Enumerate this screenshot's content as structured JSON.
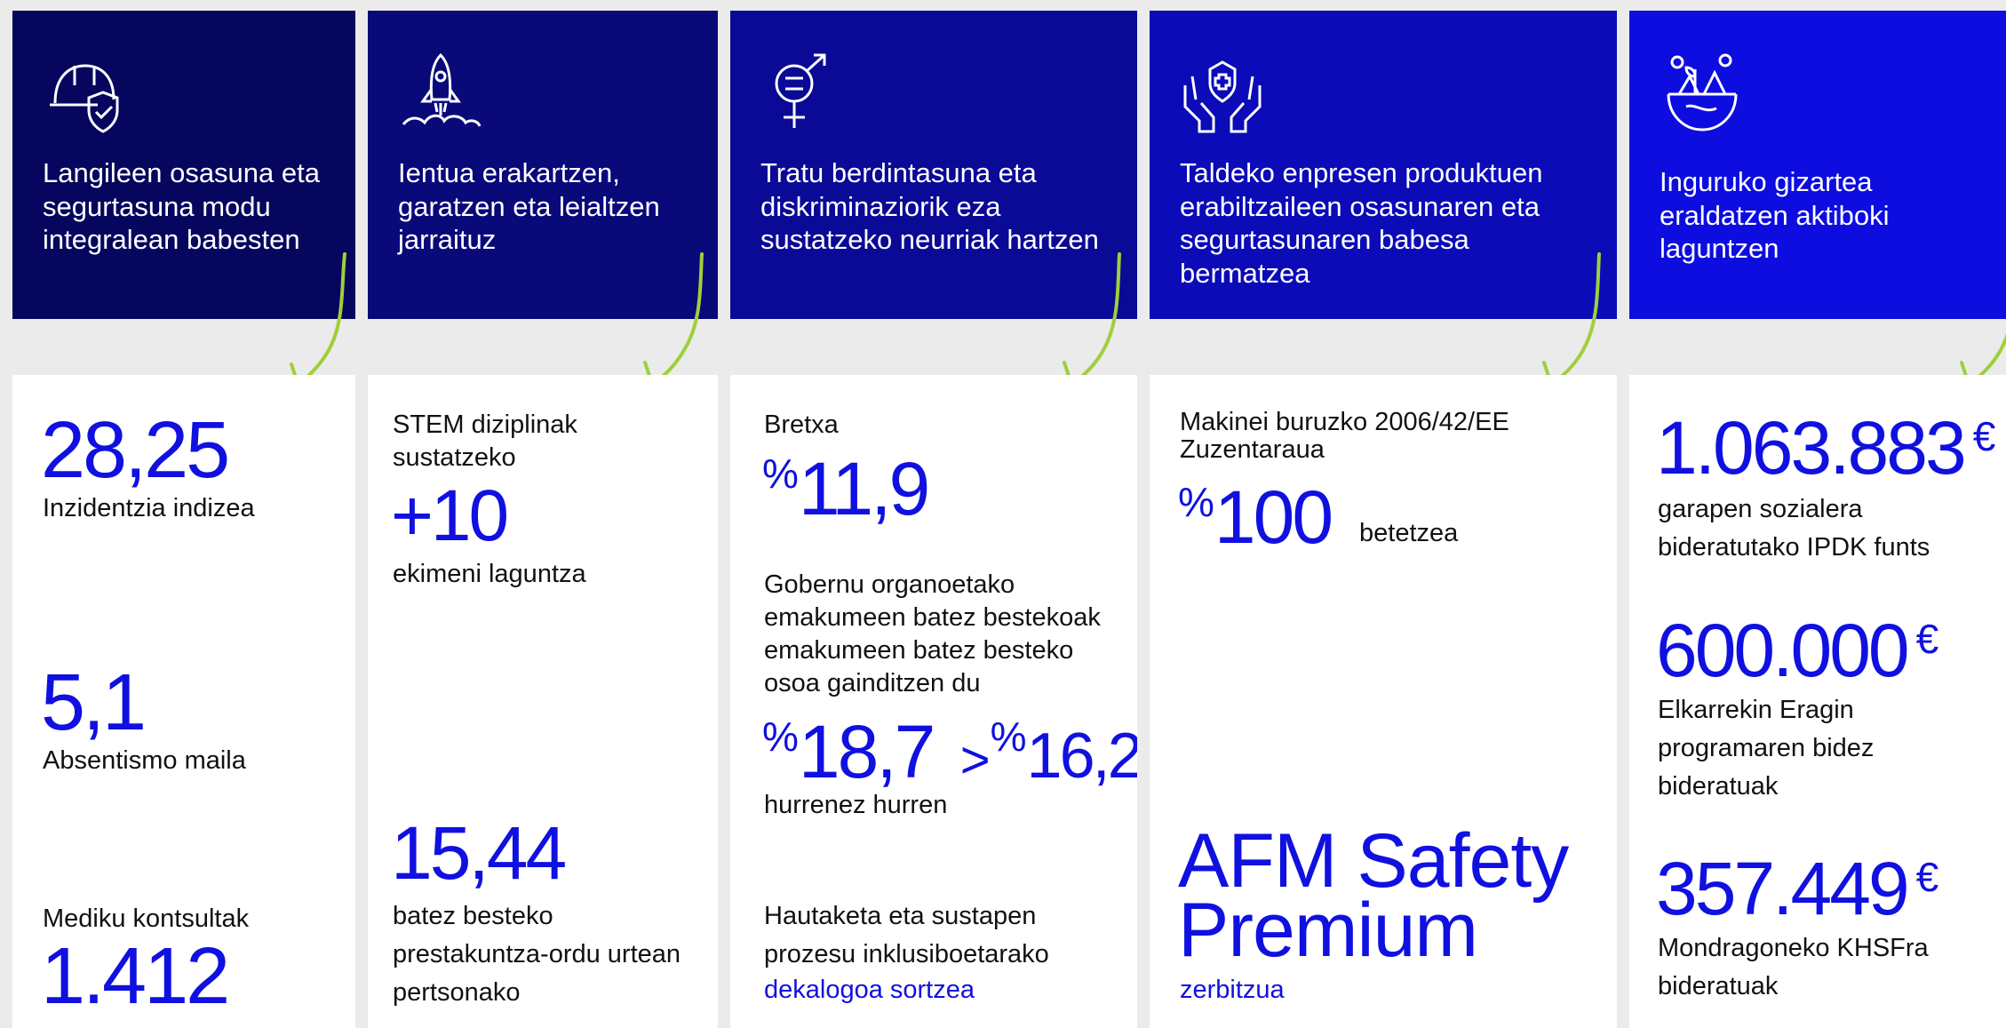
{
  "colors": {
    "accent": "#1010e0",
    "bg": "#ebebeb",
    "arrow": "#9fcf3a"
  },
  "headers": [
    {
      "icon": "helmet-shield-icon",
      "text": "Langileen osasuna eta segurtasuna modu integralean babesten"
    },
    {
      "icon": "rocket-icon",
      "text": "Ientua erakartzen, garatzen eta leialtzen jarraituz"
    },
    {
      "icon": "gender-equality-icon",
      "text": "Tratu berdintasuna eta diskriminaziorik eza sustatzeko neurriak hartzen"
    },
    {
      "icon": "hands-cross-icon",
      "text": "Taldeko enpresen produktuen erabiltzaileen osasunaren eta segurtasunaren babesa bermatzea"
    },
    {
      "icon": "globe-nature-icon",
      "text": "Inguruko gizartea eraldatzen aktiboki laguntzen"
    }
  ],
  "col1": {
    "v1": "28,25",
    "l1": "Inzidentzia indizea",
    "v2": "5,1",
    "l2": "Absentismo maila",
    "l3": "Mediku kontsultak",
    "v3": "1.412"
  },
  "col2": {
    "pre": "STEM diziplinak sustatzeko",
    "v1": "+10",
    "l1": "ekimeni laguntza",
    "v2": "15,44",
    "l2": "batez besteko prestakuntza-ordu urtean pertsonako"
  },
  "col3": {
    "pre": "Bretxa",
    "pct": "%",
    "v1": "11,9",
    "l1": "Gobernu organoetako emakumeen batez bestekoak emakumeen batez besteko osoa gainditzen du",
    "v2a": "18,7",
    "gt": ">",
    "v2b": "16,2",
    "l2": "hurrenez hurren",
    "l3": "Hautaketa eta sustapen prozesu inklusiboetarako",
    "link": "dekalogoa sortzea"
  },
  "col4": {
    "pre": "Makinei buruzko 2006/42/EE Zuzentaraua",
    "pct": "%",
    "v1": "100",
    "l1": "betetzea",
    "v2": "AFM Safety Premium",
    "link": "zerbitzua"
  },
  "col5": {
    "eur": "€",
    "v1": "1.063.883",
    "l1": "garapen sozialera bideratutako IPDK funts",
    "v2": "600.000",
    "l2": "Elkarrekin Eragin programaren bidez bideratuak",
    "v3": "357.449",
    "l3": "Mondragoneko KHSFra bideratuak"
  }
}
